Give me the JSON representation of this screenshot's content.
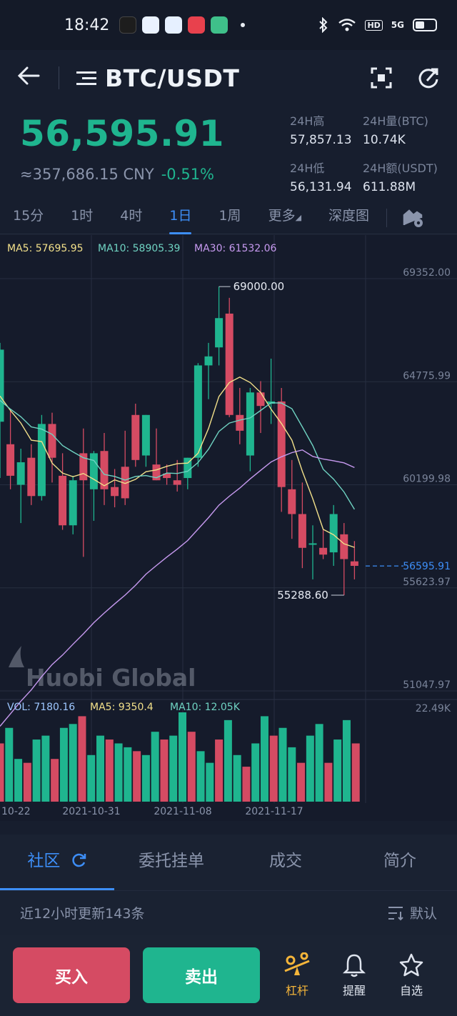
{
  "status": {
    "time": "18:42",
    "net": "5G",
    "hd": "HD"
  },
  "header": {
    "pair": "BTC/USDT"
  },
  "ticker": {
    "price": "56,595.91",
    "cny": "≈357,686.15 CNY",
    "change": "-0.51%",
    "high_label": "24H高",
    "high": "57,857.13",
    "vol_label": "24H量(BTC)",
    "vol": "10.74K",
    "low_label": "24H低",
    "low": "56,131.94",
    "amt_label": "24H额(USDT)",
    "amt": "611.88M"
  },
  "timeframes": [
    "15分",
    "1时",
    "4时",
    "1日",
    "1周",
    "更多",
    "深度图"
  ],
  "active_timeframe": "1日",
  "indicators": {
    "ma5": "MA5: 57695.95",
    "ma10": "MA10: 58905.39",
    "ma30": "MA30: 61532.06"
  },
  "vol_indicators": {
    "vol": "VOL: 7180.16",
    "ma5": "MA5: 9350.4",
    "ma10": "MA10: 12.05K"
  },
  "watermark": "Huobi Global",
  "colors": {
    "up": "#1fb58f",
    "down": "#d54b63",
    "accent": "#3d8ef7",
    "ma5": "#f2e08a",
    "ma10": "#6fd3c2",
    "ma30": "#c79af0"
  },
  "chart_data": {
    "type": "candlestick",
    "price_axis": [
      "69352.00",
      "64775.99",
      "60199.98",
      "55623.97",
      "51047.97"
    ],
    "ylim": [
      51047.97,
      69352.0
    ],
    "last_price_label": "56595.91",
    "high_label": "69000.00",
    "low_label": "55288.60",
    "vol_max_label": "22.49K",
    "x_dates": [
      "10-22",
      "2021-10-31",
      "2021-11-08",
      "2021-11-17"
    ],
    "candles": [
      {
        "o": 63000,
        "h": 66500,
        "l": 60500,
        "c": 66200
      },
      {
        "o": 62000,
        "h": 63500,
        "l": 60000,
        "c": 60600
      },
      {
        "o": 60200,
        "h": 61800,
        "l": 58500,
        "c": 61200
      },
      {
        "o": 61400,
        "h": 62000,
        "l": 59300,
        "c": 59700
      },
      {
        "o": 59700,
        "h": 63300,
        "l": 59500,
        "c": 62900
      },
      {
        "o": 62900,
        "h": 63400,
        "l": 60300,
        "c": 61400
      },
      {
        "o": 60600,
        "h": 61600,
        "l": 58200,
        "c": 58400
      },
      {
        "o": 58400,
        "h": 60600,
        "l": 58000,
        "c": 60400
      },
      {
        "o": 61600,
        "h": 62700,
        "l": 57000,
        "c": 60400
      },
      {
        "o": 60000,
        "h": 61700,
        "l": 58600,
        "c": 61600
      },
      {
        "o": 61700,
        "h": 62500,
        "l": 59300,
        "c": 60000
      },
      {
        "o": 60100,
        "h": 60900,
        "l": 59200,
        "c": 59700
      },
      {
        "o": 61000,
        "h": 62600,
        "l": 59300,
        "c": 59600
      },
      {
        "o": 63300,
        "h": 63800,
        "l": 61000,
        "c": 61300
      },
      {
        "o": 61500,
        "h": 63300,
        "l": 61000,
        "c": 63300
      },
      {
        "o": 61100,
        "h": 62700,
        "l": 60400,
        "c": 60400
      },
      {
        "o": 60700,
        "h": 61100,
        "l": 60200,
        "c": 60500
      },
      {
        "o": 60400,
        "h": 61300,
        "l": 59900,
        "c": 60200
      },
      {
        "o": 60500,
        "h": 61400,
        "l": 60000,
        "c": 61400
      },
      {
        "o": 61400,
        "h": 65600,
        "l": 61000,
        "c": 65500
      },
      {
        "o": 65500,
        "h": 66500,
        "l": 64000,
        "c": 65900
      },
      {
        "o": 66300,
        "h": 69000,
        "l": 65500,
        "c": 67600
      },
      {
        "o": 67800,
        "h": 68500,
        "l": 63200,
        "c": 63300
      },
      {
        "o": 63300,
        "h": 64500,
        "l": 62000,
        "c": 62600
      },
      {
        "o": 61500,
        "h": 64500,
        "l": 60800,
        "c": 64300
      },
      {
        "o": 64300,
        "h": 64800,
        "l": 62500,
        "c": 63700
      },
      {
        "o": 63800,
        "h": 65800,
        "l": 62900,
        "c": 63900
      },
      {
        "o": 63900,
        "h": 64500,
        "l": 59000,
        "c": 60100
      },
      {
        "o": 60000,
        "h": 61300,
        "l": 57800,
        "c": 58900
      },
      {
        "o": 58900,
        "h": 60300,
        "l": 56500,
        "c": 57400
      },
      {
        "o": 57600,
        "h": 58400,
        "l": 56000,
        "c": 57600
      },
      {
        "o": 57400,
        "h": 58200,
        "l": 56900,
        "c": 57100
      },
      {
        "o": 57200,
        "h": 59300,
        "l": 56600,
        "c": 58900
      },
      {
        "o": 58000,
        "h": 58500,
        "l": 55300,
        "c": 56900
      },
      {
        "o": 56800,
        "h": 57700,
        "l": 56000,
        "c": 56600
      }
    ],
    "volumes": [
      15,
      19,
      11,
      10,
      16,
      17,
      11,
      19,
      20,
      22,
      12,
      17,
      16,
      15,
      14,
      13,
      12,
      18,
      16,
      17,
      23,
      18,
      13,
      10,
      16,
      21,
      12,
      9,
      15,
      22,
      17,
      19,
      14,
      10,
      17,
      20,
      10,
      16,
      21,
      15
    ],
    "vol_colors": "mixed"
  },
  "bottom_tabs": [
    "社区",
    "委托挂单",
    "成交",
    "简介"
  ],
  "feed": {
    "summary": "近12小时更新143条",
    "sort": "默认"
  },
  "actions": {
    "buy": "买入",
    "sell": "卖出",
    "leverage": "杠杆",
    "alert": "提醒",
    "watch": "自选"
  }
}
